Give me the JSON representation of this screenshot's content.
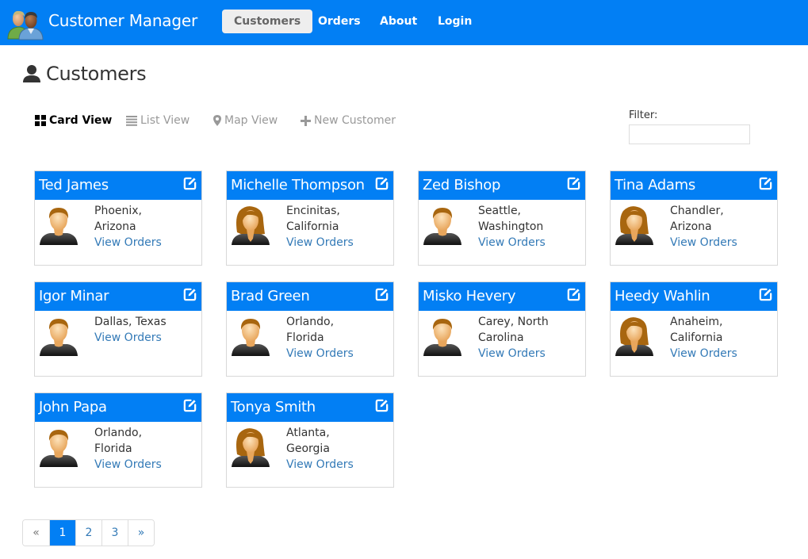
{
  "app": {
    "brand": "Customer Manager",
    "logo_icon": "users-icon"
  },
  "nav": {
    "items": [
      {
        "label": "Customers",
        "active": true
      },
      {
        "label": "Orders",
        "active": false
      },
      {
        "label": "About",
        "active": false
      },
      {
        "label": "Login",
        "active": false
      }
    ]
  },
  "page": {
    "title": "Customers",
    "title_icon": "user-icon"
  },
  "toolbar": {
    "items": [
      {
        "label": "Card View",
        "icon": "grid-icon",
        "active": true
      },
      {
        "label": "List View",
        "icon": "list-icon",
        "active": false
      },
      {
        "label": "Map View",
        "icon": "map-marker-icon",
        "active": false
      },
      {
        "label": "New Customer",
        "icon": "plus-icon",
        "active": false
      }
    ]
  },
  "filter": {
    "label": "Filter:",
    "value": "",
    "placeholder": ""
  },
  "cards": {
    "link_label": "View Orders",
    "edit_icon": "edit-icon",
    "colors": {
      "header": "#027ff4",
      "link": "#337ab7"
    },
    "items": [
      {
        "name": "Ted James",
        "gender": "male",
        "line1": "Phoenix,",
        "line2": "Arizona"
      },
      {
        "name": "Michelle Thompson",
        "gender": "female",
        "line1": "Encinitas,",
        "line2": "California"
      },
      {
        "name": "Zed Bishop",
        "gender": "male",
        "line1": "Seattle,",
        "line2": "Washington"
      },
      {
        "name": "Tina Adams",
        "gender": "female",
        "line1": "Chandler,",
        "line2": "Arizona"
      },
      {
        "name": "Igor Minar",
        "gender": "male",
        "line1": "Dallas, Texas",
        "line2": ""
      },
      {
        "name": "Brad Green",
        "gender": "male",
        "line1": "Orlando,",
        "line2": "Florida"
      },
      {
        "name": "Misko Hevery",
        "gender": "male",
        "line1": "Carey, North",
        "line2": "Carolina"
      },
      {
        "name": "Heedy Wahlin",
        "gender": "female",
        "line1": "Anaheim,",
        "line2": "California"
      },
      {
        "name": "John Papa",
        "gender": "male",
        "line1": "Orlando,",
        "line2": "Florida"
      },
      {
        "name": "Tonya Smith",
        "gender": "female",
        "line1": "Atlanta,",
        "line2": "Georgia"
      }
    ]
  },
  "pagination": {
    "prev": "«",
    "next": "»",
    "pages": [
      "1",
      "2",
      "3"
    ],
    "current": "1"
  }
}
